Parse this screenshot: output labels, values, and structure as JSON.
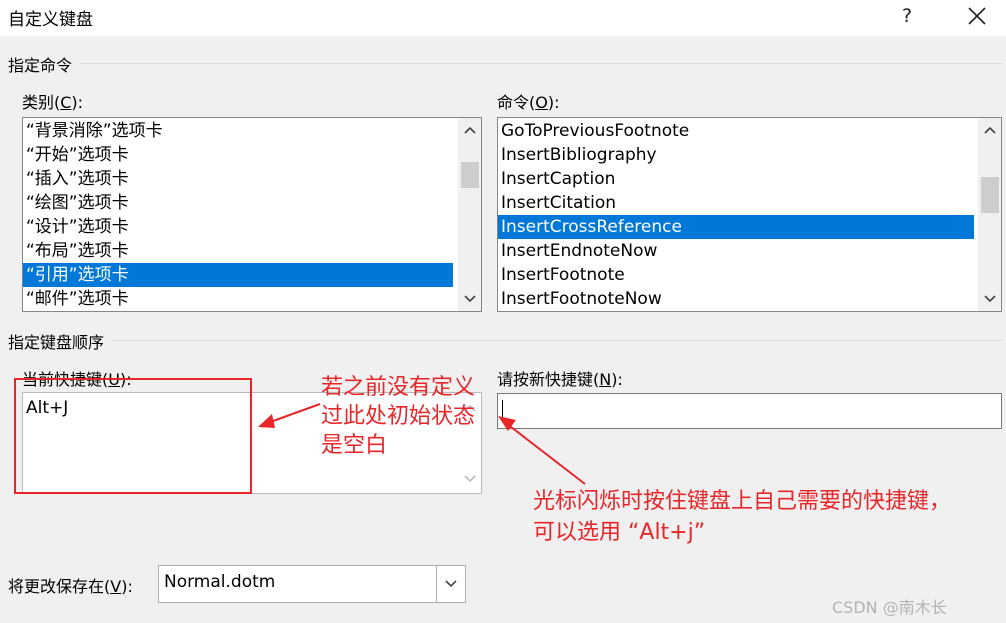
{
  "dialog": {
    "title": "自定义键盘",
    "help_glyph": "?"
  },
  "sections": {
    "specify_command": "指定命令",
    "specify_key_sequence": "指定键盘顺序"
  },
  "categories": {
    "label_prefix": "类别(",
    "label_key": "C",
    "label_suffix": "):",
    "items": [
      "“背景消除”选项卡",
      "“开始”选项卡",
      "“插入”选项卡",
      "“绘图”选项卡",
      "“设计”选项卡",
      "“布局”选项卡",
      "“引用”选项卡",
      "“邮件”选项卡"
    ],
    "selected_index": 6
  },
  "commands": {
    "label_prefix": "命令(",
    "label_key": "O",
    "label_suffix": "):",
    "items": [
      "GoToPreviousFootnote",
      "InsertBibliography",
      "InsertCaption",
      "InsertCitation",
      "InsertCrossReference",
      "InsertEndnoteNow",
      "InsertFootnote",
      "InsertFootnoteNow"
    ],
    "selected_index": 4
  },
  "current_keys": {
    "label_prefix": "当前快捷键(",
    "label_key": "U",
    "label_suffix": "):",
    "value": "Alt+J"
  },
  "new_shortcut": {
    "label_prefix": "请按新快捷键(",
    "label_key": "N",
    "label_suffix": "):",
    "value": ""
  },
  "save_in": {
    "label_prefix": "将更改保存在(",
    "label_key": "V",
    "label_suffix": "):",
    "value": "Normal.dotm"
  },
  "annotations": {
    "note1": [
      "若之前没有定义",
      "过此处初始状态",
      "是空白"
    ],
    "note2": [
      "光标闪烁时按住键盘上自己需要的快捷键，",
      "可以选用 “Alt+j”"
    ],
    "color": "#e8262a"
  },
  "watermark": "CSDN @南木长",
  "colors": {
    "selection": "#0078d7",
    "dialog_bg": "#f0f0f0"
  }
}
